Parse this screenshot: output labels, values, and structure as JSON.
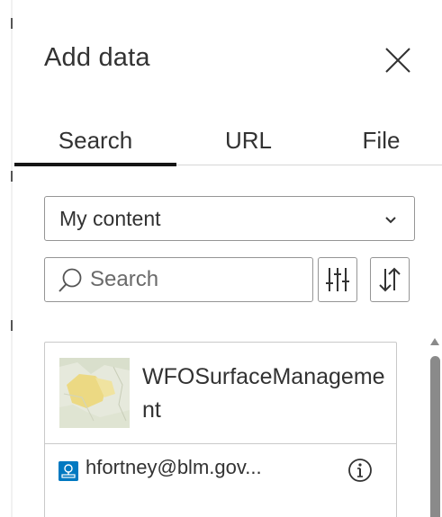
{
  "panel": {
    "title": "Add data",
    "close_icon": "close-icon"
  },
  "tabs": [
    {
      "label": "Search",
      "active": true
    },
    {
      "label": "URL",
      "active": false
    },
    {
      "label": "File",
      "active": false
    }
  ],
  "source_select": {
    "selected": "My content",
    "icon": "chevron-down-icon"
  },
  "search": {
    "value": "",
    "placeholder": "Search",
    "icon": "search-icon"
  },
  "toolbar": {
    "filter_icon": "filter-sliders-icon",
    "sort_icon": "sort-icon"
  },
  "results": [
    {
      "title": "WFOSurfaceManagement",
      "owner": "hfortney@blm.gov...",
      "owner_icon": "feature-layer-icon",
      "info_icon": "info-icon",
      "thumbnail_icon": "map-thumbnail"
    }
  ],
  "colors": {
    "accent": "#151515",
    "owner_icon_bg": "#0079c1",
    "border": "#959595"
  }
}
